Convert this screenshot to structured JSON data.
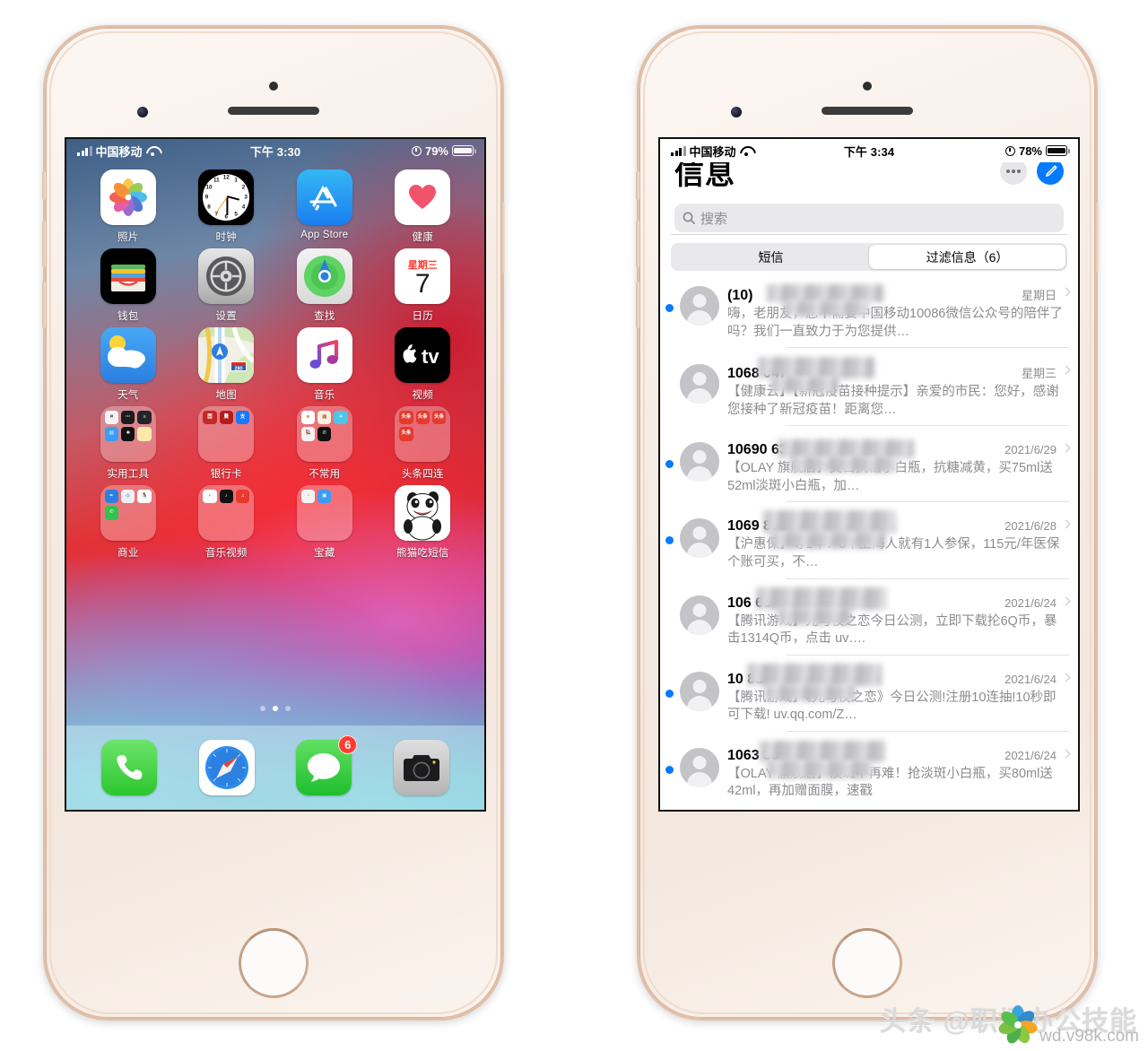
{
  "left_phone": {
    "status_bar": {
      "carrier": "中国移动",
      "time": "下午 3:30",
      "battery": "79%"
    },
    "app_rows": [
      [
        {
          "label": "照片",
          "icon": "photos-icon"
        },
        {
          "label": "时钟",
          "icon": "clock-icon"
        },
        {
          "label": "App Store",
          "icon": "appstore-icon"
        },
        {
          "label": "健康",
          "icon": "health-icon"
        }
      ],
      [
        {
          "label": "钱包",
          "icon": "wallet-icon"
        },
        {
          "label": "设置",
          "icon": "settings-icon"
        },
        {
          "label": "查找",
          "icon": "findmy-icon"
        },
        {
          "label": "日历",
          "icon": "calendar-icon",
          "weekday": "星期三",
          "day": "7"
        }
      ],
      [
        {
          "label": "天气",
          "icon": "weather-icon"
        },
        {
          "label": "地图",
          "icon": "maps-icon",
          "route": "280"
        },
        {
          "label": "音乐",
          "icon": "music-icon"
        },
        {
          "label": "视频",
          "icon": "appletv-icon",
          "glyph": "tv"
        }
      ],
      [
        {
          "label": "实用工具",
          "icon": "folder-icon"
        },
        {
          "label": "银行卡",
          "icon": "folder-icon"
        },
        {
          "label": "不常用",
          "icon": "folder-icon"
        },
        {
          "label": "头条四连",
          "icon": "folder-icon"
        }
      ],
      [
        {
          "label": "商业",
          "icon": "folder-icon"
        },
        {
          "label": "音乐视频",
          "icon": "folder-icon"
        },
        {
          "label": "宝藏",
          "icon": "folder-icon"
        },
        {
          "label": "熊猫吃短信",
          "icon": "panda-icon"
        }
      ]
    ],
    "page_dots": {
      "count": 3,
      "active_index": 1
    },
    "dock": [
      {
        "label": "电话",
        "icon": "phone-icon"
      },
      {
        "label": "Safari",
        "icon": "safari-icon"
      },
      {
        "label": "信息",
        "icon": "messages-icon",
        "badge": "6"
      },
      {
        "label": "相机",
        "icon": "camera-icon"
      }
    ]
  },
  "right_phone": {
    "status_bar": {
      "carrier": "中国移动",
      "time": "下午 3:34",
      "battery": "78%"
    },
    "app": {
      "title": "信息",
      "more_label": "…",
      "compose_label": "新建信息",
      "search": {
        "placeholder": "搜索",
        "value": ""
      },
      "segments": [
        {
          "label": "短信",
          "active": false
        },
        {
          "label": "过滤信息（6）",
          "active": true
        }
      ],
      "threads": [
        {
          "unread": true,
          "name": "(10)",
          "time": "星期日",
          "preview": "嗨，老朋友，您不需要中国移动10086微信公众号的陪伴了吗？我们一直致力于为您提供…"
        },
        {
          "unread": false,
          "name": "1068          047",
          "time": "星期三",
          "preview": "【健康云】【新冠疫苗接种提示】亲爱的市民：您好，感谢您接种了新冠疫苗！距离您…"
        },
        {
          "unread": true,
          "name": "10690                63",
          "time": "2021/6/29",
          "preview": "【OLAY 旗舰店】美白抗糖小白瓶，抗糖减黄，买75ml送52ml淡斑小白瓶，加…"
        },
        {
          "unread": true,
          "name": "1069            898",
          "time": "2021/6/28",
          "preview": "【沪惠保】等1年！3个上海人就有1人参保，115元/年医保个账可买，不…"
        },
        {
          "unread": false,
          "name": "106             66",
          "time": "2021/6/24",
          "preview": "【腾讯游戏】光与夜之恋今日公测，立即下载抡6Q币，暴击1314Q币，点击 uv…."
        },
        {
          "unread": true,
          "name": "10              83",
          "time": "2021/6/24",
          "preview": "【腾讯游戏】《光与夜之恋》今日公测!注册10连抽!10秒即可下载! uv.qq.com/Z…"
        },
        {
          "unread": true,
          "name": "1063          39",
          "time": "2021/6/24",
          "preview": "【OLAY 旗舰店】淡斑不再难！抢淡斑小白瓶，买80ml送42ml，再加赠面膜，速戳"
        }
      ]
    }
  },
  "watermark": {
    "text": "头条 @职场办公技能",
    "site": "wd.v98k.com"
  },
  "colors": {
    "accent_blue": "#057aff",
    "badge_red": "#ff3b30",
    "segment_bg": "#e9e9eb",
    "secondary_text": "#8c8c90"
  }
}
